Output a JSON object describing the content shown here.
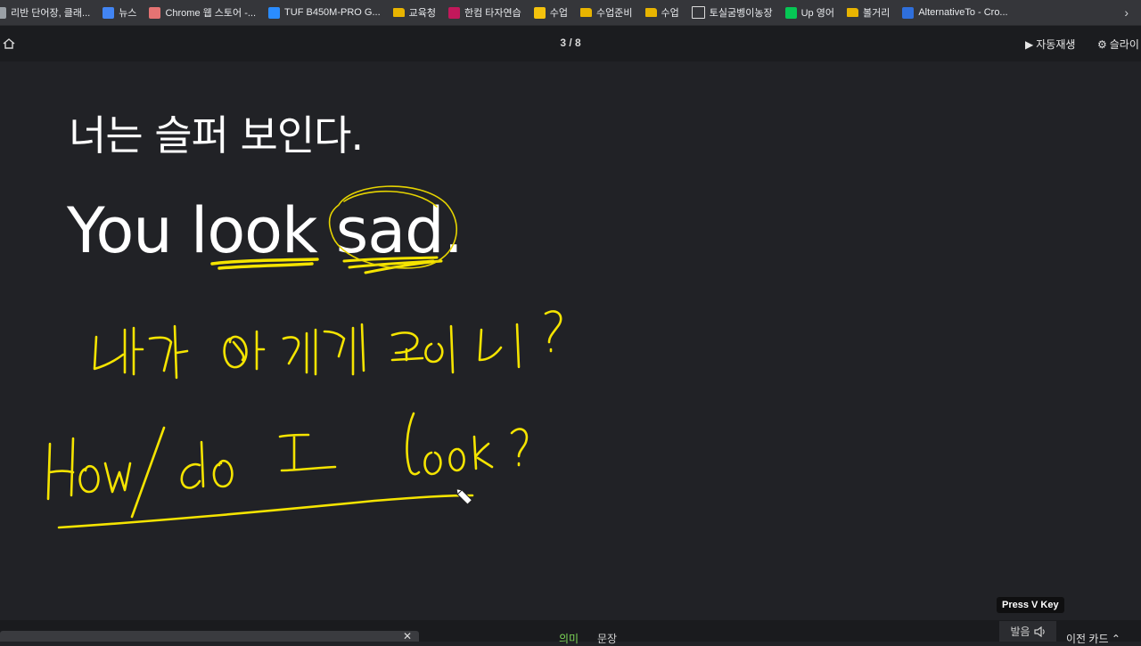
{
  "bookmarks": [
    {
      "label": "리반 단어장, 클래...",
      "icon": "globe-icon",
      "color": "#9aa0a6"
    },
    {
      "label": "뉴스",
      "icon": "news-icon",
      "color": "#4285f4"
    },
    {
      "label": "Chrome 웹 스토어 -...",
      "icon": "chrome-store-icon",
      "color": "#e57373"
    },
    {
      "label": "TUF B450M-PRO G...",
      "icon": "asus-icon",
      "color": "#2a8cff"
    },
    {
      "label": "교육청",
      "icon": "folder-icon",
      "color": "#e8b400"
    },
    {
      "label": "한컴 타자연습",
      "icon": "hancom-icon",
      "color": "#c2185b"
    },
    {
      "label": "수업",
      "icon": "classroom-icon",
      "color": "#f4c20d"
    },
    {
      "label": "수업준비",
      "icon": "folder-icon",
      "color": "#e8b400"
    },
    {
      "label": "수업",
      "icon": "folder-icon",
      "color": "#e8b400"
    },
    {
      "label": "토실굼벵이농장",
      "icon": "document-icon",
      "color": "#dcdcdc"
    },
    {
      "label": "Up 영어",
      "icon": "line-icon",
      "color": "#06c755"
    },
    {
      "label": "볼거리",
      "icon": "folder-icon",
      "color": "#e8b400"
    },
    {
      "label": "AlternativeTo - Cro...",
      "icon": "alternativeto-icon",
      "color": "#2f6fdb"
    }
  ],
  "topbar": {
    "counter": "3 / 8",
    "autoplay_label": "자동재생",
    "slide_settings_label": "슬라이"
  },
  "card": {
    "korean": "너는 슬퍼 보인다.",
    "english": "You look sad."
  },
  "handwriting": {
    "line1": "내가 어떻게 보이니?",
    "line2": "How/do I look?",
    "ink_color": "#f5e400"
  },
  "bottom": {
    "tab_meaning": "의미",
    "tab_sentence": "문장",
    "sound_label": "발음",
    "prev_card_label": "이전 카드",
    "tooltip": "Press V Key"
  }
}
